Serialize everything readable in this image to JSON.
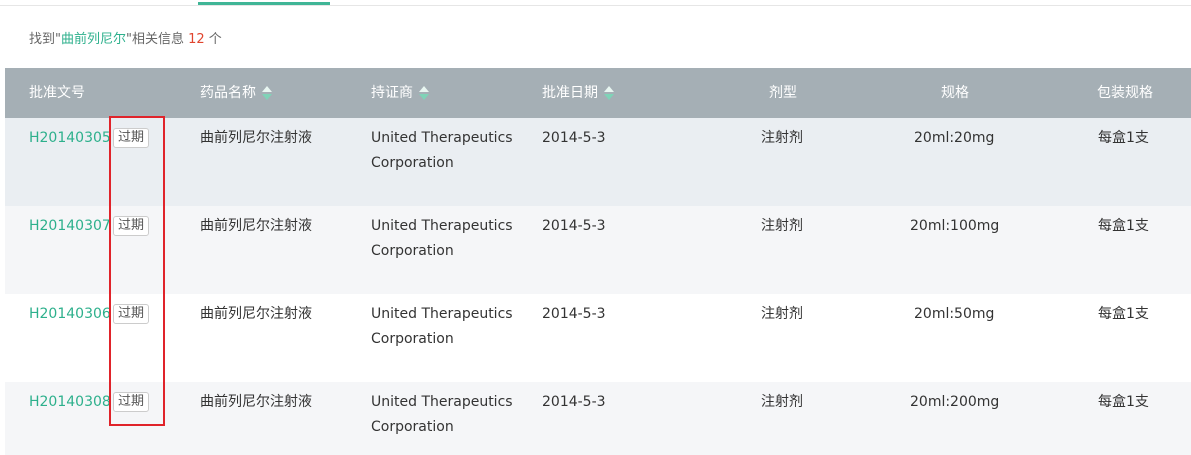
{
  "summary": {
    "prefix": "找到\"",
    "keyword": "曲前列尼尔",
    "middle": "\"相关信息 ",
    "count": "12",
    "suffix": " 个"
  },
  "table": {
    "headers": {
      "code": "批准文号",
      "name": "药品名称",
      "holder": "持证商",
      "date": "批准日期",
      "form": "剂型",
      "spec": "规格",
      "pack": "包装规格"
    },
    "rows": [
      {
        "code": "H20140305",
        "status": "过期",
        "name": "曲前列尼尔注射液",
        "holder": "United Therapeutics Corporation",
        "date": "2014-5-3",
        "form": "注射剂",
        "spec": "20ml:20mg",
        "pack": "每盒1支"
      },
      {
        "code": "H20140307",
        "status": "过期",
        "name": "曲前列尼尔注射液",
        "holder": "United Therapeutics Corporation",
        "date": "2014-5-3",
        "form": "注射剂",
        "spec": "20ml:100mg",
        "pack": "每盒1支"
      },
      {
        "code": "H20140306",
        "status": "过期",
        "name": "曲前列尼尔注射液",
        "holder": "United Therapeutics Corporation",
        "date": "2014-5-3",
        "form": "注射剂",
        "spec": "20ml:50mg",
        "pack": "每盒1支"
      },
      {
        "code": "H20140308",
        "status": "过期",
        "name": "曲前列尼尔注射液",
        "holder": "United Therapeutics Corporation",
        "date": "2014-5-3",
        "form": "注射剂",
        "spec": "20ml:200mg",
        "pack": "每盒1支"
      }
    ]
  },
  "colors": {
    "accent": "#2db08c",
    "header_bg": "#a5afb5",
    "count": "#e0452e",
    "highlight": "#e0232a"
  }
}
